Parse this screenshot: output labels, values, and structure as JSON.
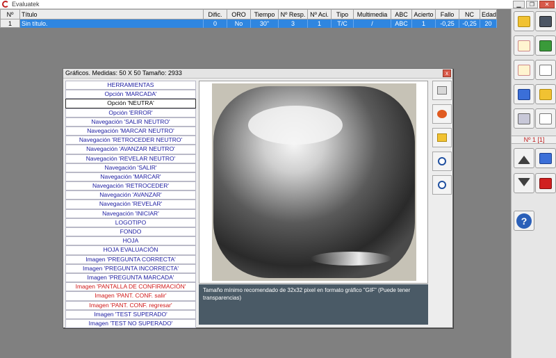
{
  "window": {
    "title": "Evaluatek"
  },
  "grid": {
    "headers": [
      "Nº",
      "Título",
      "Dific.",
      "ORO",
      "Tiempo",
      "Nº Resp.",
      "Nº Aci.",
      "Tipo",
      "Multimedia",
      "ABC",
      "Acierto",
      "Fallo",
      "NC",
      "Edad"
    ],
    "rows": [
      [
        "1",
        "Sin título.",
        "0",
        "No",
        "30\"",
        "3",
        "1",
        "T/C",
        "/",
        "ABC",
        "1",
        "-0,25",
        "-0,25",
        "20"
      ]
    ]
  },
  "toolbar": {
    "question_counter": "Nº 1 [1]",
    "help_label": "?"
  },
  "dialog": {
    "title": "Gráficos. Medidas:  50 X  50  Tamaño:  2933",
    "close_label": "x",
    "options": [
      {
        "label": "HERRAMIENTAS",
        "color": "blue"
      },
      {
        "label": "Opción 'MARCADA'",
        "color": "blue"
      },
      {
        "label": "Opción 'NEUTRA'",
        "color": "black",
        "selected": true
      },
      {
        "label": "Opción 'ERROR'",
        "color": "blue"
      },
      {
        "label": "Navegación 'SALIR NEUTRO'",
        "color": "blue"
      },
      {
        "label": "Navegación 'MARCAR NEUTRO'",
        "color": "blue"
      },
      {
        "label": "Navegación 'RETROCEDER NEUTRO'",
        "color": "blue"
      },
      {
        "label": "Navegación 'AVANZAR NEUTRO'",
        "color": "blue"
      },
      {
        "label": "Navegación 'REVELAR NEUTRO'",
        "color": "blue"
      },
      {
        "label": "Navegación 'SALIR'",
        "color": "blue"
      },
      {
        "label": "Navegación 'MARCAR'",
        "color": "blue"
      },
      {
        "label": "Navegación 'RETROCEDER'",
        "color": "blue"
      },
      {
        "label": "Navegación 'AVANZAR'",
        "color": "blue"
      },
      {
        "label": "Navegación 'REVELAR'",
        "color": "blue"
      },
      {
        "label": "Navegación 'INICIAR'",
        "color": "blue"
      },
      {
        "label": "LOGOTIPO",
        "color": "blue"
      },
      {
        "label": "FONDO",
        "color": "blue"
      },
      {
        "label": "HOJA",
        "color": "blue"
      },
      {
        "label": "HOJA EVALUACIÓN",
        "color": "blue"
      },
      {
        "label": "Imagen 'PREGUNTA CORRECTA'",
        "color": "blue"
      },
      {
        "label": "Imagen 'PREGUNTA INCORRECTA'",
        "color": "blue"
      },
      {
        "label": "Imagen 'PREGUNTA MARCADA'",
        "color": "blue"
      },
      {
        "label": "Imagen 'PANTALLA DE CONFIRMACIÓN'",
        "color": "red"
      },
      {
        "label": "Imagen 'PANT. CONF. salir'",
        "color": "red"
      },
      {
        "label": "Imagen 'PANT. CONF. regresar'",
        "color": "red"
      },
      {
        "label": "Imagen 'TEST SUPERADO'",
        "color": "blue"
      },
      {
        "label": "Imagen 'TEST NO SUPERADO'",
        "color": "blue"
      }
    ],
    "info_text": "Tamaño mínimo recomendado de 32x32 pixel en formato gráfico \"GIF\" (Puede tener transparencias)"
  },
  "colors": {
    "selection_row": "#2f86e0",
    "option_blue": "#1a1aa0",
    "option_red": "#d01818",
    "info_bg": "#4a5a66"
  }
}
